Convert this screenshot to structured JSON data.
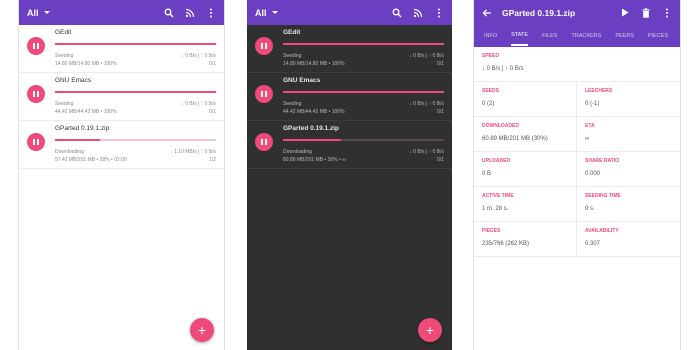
{
  "colors": {
    "primary": "#6a3fc2",
    "accent": "#ee4a7a"
  },
  "toolbar": {
    "filter": "All",
    "icons": [
      "search-icon",
      "rss-icon",
      "more-vert-icon"
    ]
  },
  "torrents": [
    {
      "name": "GEdit",
      "status": "Seeding",
      "info": "14.80 MB/14.80 MB • 100%",
      "speed": "↓ 0 B/s | ↑ 0 B/s",
      "ratio": "0/1",
      "progress": 1.0
    },
    {
      "name": "GNU Emacs",
      "status": "Seeding",
      "info": "44.42 MB/44.42 MB • 100%",
      "speed": "↓ 0 B/s | ↑ 0 B/s",
      "ratio": "0/1",
      "progress": 1.0
    },
    {
      "name": "GParted 0.19.1.zip",
      "status": "Downloading",
      "info": "57.42 MB/201 MB • 28% • 02:09",
      "speed": "↓ 1.10 MB/s | ↑ 0 B/s",
      "ratio": "1/2",
      "progress": 0.28
    }
  ],
  "torrents_dark": [
    {
      "name": "GEdit",
      "status": "Seeding",
      "info": "14.80 MB/14.80 MB • 100%",
      "speed": "↓ 0 B/s | ↑ 0 B/s",
      "ratio": "0/1",
      "progress": 1.0
    },
    {
      "name": "GNU Emacs",
      "status": "Seeding",
      "info": "44.42 MB/44.42 MB • 100%",
      "speed": "↓ 0 B/s | ↑ 0 B/s",
      "ratio": "0/1",
      "progress": 1.0
    },
    {
      "name": "GParted 0.19.1.zip",
      "status": "Downloading",
      "info": "80.89 MB/201 MB • 36% • ∞",
      "speed": "↓ 0 B/s | ↑ 0 B/s",
      "ratio": "0/1",
      "progress": 0.36
    }
  ],
  "fab": {
    "label": "+"
  },
  "detail": {
    "title": "GParted 0.19.1.zip",
    "tabs": [
      "INFO",
      "STATE",
      "FILES",
      "TRACKERS",
      "PEERS",
      "PIECES"
    ],
    "active_tab": "STATE",
    "speed": {
      "label": "SPEED",
      "value": "↓ 0 B/s | ↑ 0 B/s"
    },
    "seeds": {
      "label": "SEEDS",
      "value": "0 (2)"
    },
    "leechers": {
      "label": "LEECHERS",
      "value": "0 (-1)"
    },
    "downloaded": {
      "label": "DOWNLOADED",
      "value": "60.89 MB/201 MB (30%)"
    },
    "eta": {
      "label": "ETA",
      "value": "∞"
    },
    "uploaded": {
      "label": "UPLOADED",
      "value": "0 B"
    },
    "share_ratio": {
      "label": "SHARE RATIO",
      "value": "0.000"
    },
    "active_time": {
      "label": "ACTIVE TIME",
      "value": "1 m. 28 s."
    },
    "seeding_time": {
      "label": "SEEDING TIME",
      "value": "0 s."
    },
    "pieces": {
      "label": "PIECES",
      "value": "235/766 (262 KB)"
    },
    "availability": {
      "label": "AVAILABILITY",
      "value": "0.307"
    }
  }
}
